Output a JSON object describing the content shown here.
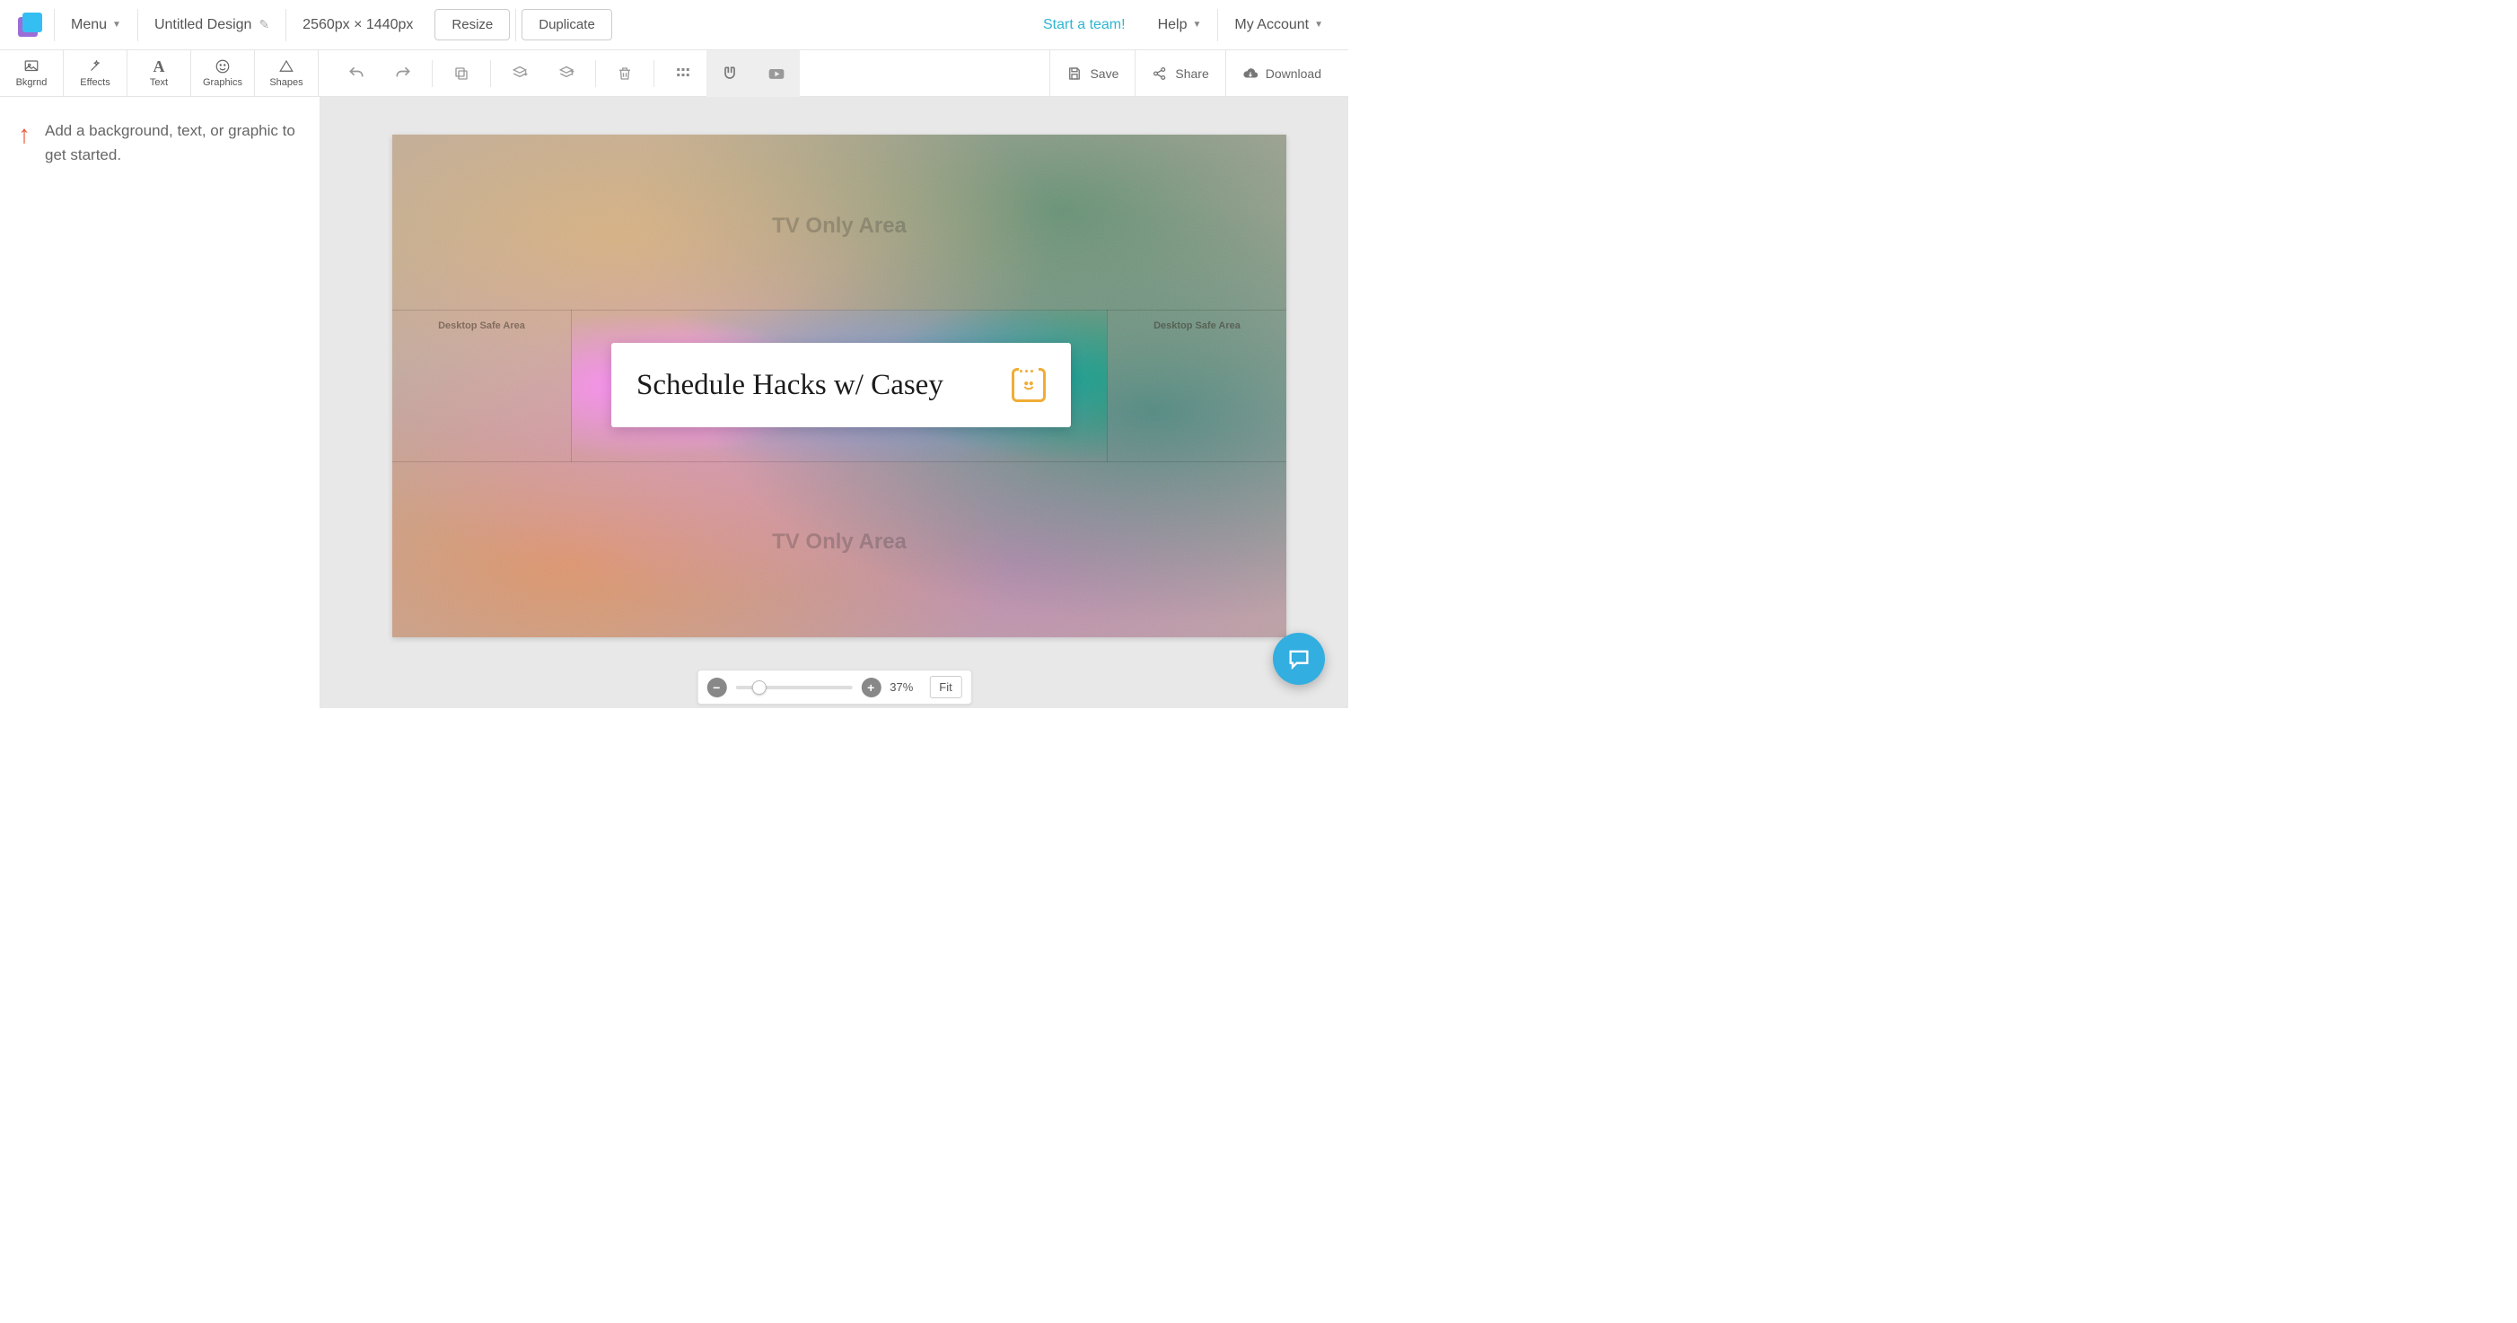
{
  "header": {
    "menu_label": "Menu",
    "design_title": "Untitled Design",
    "dimensions": "2560px × 1440px",
    "resize_label": "Resize",
    "duplicate_label": "Duplicate",
    "start_team_label": "Start a team!",
    "help_label": "Help",
    "account_label": "My Account"
  },
  "sidebar_tabs": {
    "bkgrnd": "Bkgrnd",
    "effects": "Effects",
    "text": "Text",
    "graphics": "Graphics",
    "shapes": "Shapes"
  },
  "toolbar_actions": {
    "save": "Save",
    "share": "Share",
    "download": "Download"
  },
  "sidebar_hint": "Add a background, text, or graphic to get started.",
  "canvas": {
    "tv_area_label": "TV Only Area",
    "desktop_safe_label": "Desktop Safe Area",
    "title_text": "Schedule Hacks w/ Casey"
  },
  "zoom": {
    "value": "37%",
    "fit_label": "Fit"
  }
}
